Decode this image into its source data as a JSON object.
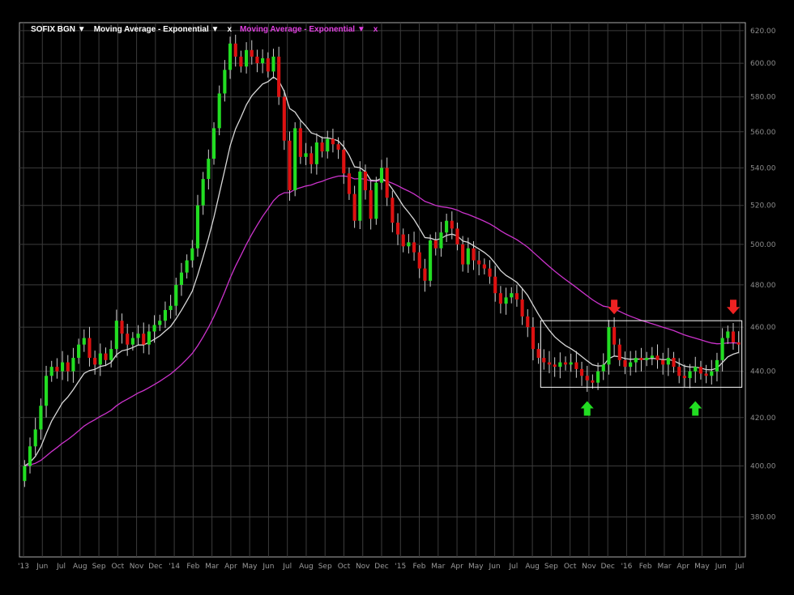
{
  "legend": {
    "symbol": "SOFIX BGN ▼",
    "ma1_label": "Moving Average - Exponential ▼",
    "ma1_close": "x",
    "ma2_label": "Moving Average - Exponential ▼",
    "ma2_close": "x"
  },
  "colors": {
    "background": "#000000",
    "grid": "#3c3c3c",
    "up": "#22dd22",
    "down": "#dd1111",
    "ma_fast": "#d8d8d8",
    "ma_slow": "#cc33cc",
    "box": "#ffffff",
    "arrow_up": "#22dd22",
    "arrow_down": "#ee2222"
  },
  "chart_data": {
    "type": "candlestick",
    "title": "",
    "xlabel": "",
    "ylabel": "",
    "ylim": [
      365,
      625
    ],
    "y_scale": "log",
    "y_ticks": [
      380,
      400,
      420,
      440,
      460,
      480,
      500,
      520,
      540,
      560,
      580,
      600,
      620
    ],
    "x_ticks": [
      "'13",
      "Jun",
      "Jul",
      "Aug",
      "Sep",
      "Oct",
      "Nov",
      "Dec",
      "'14",
      "Feb",
      "Mar",
      "Apr",
      "May",
      "Jun",
      "Jul",
      "Aug",
      "Sep",
      "Oct",
      "Nov",
      "Dec",
      "'15",
      "Feb",
      "Mar",
      "Apr",
      "May",
      "Jun",
      "Jul",
      "Aug",
      "Sep",
      "Oct",
      "Nov",
      "Dec",
      "'16",
      "Feb",
      "Mar",
      "Apr",
      "May",
      "Jun",
      "Jul"
    ],
    "close": [
      400,
      408,
      415,
      425,
      438,
      442,
      440,
      444,
      440,
      446,
      452,
      455,
      446,
      443,
      448,
      445,
      450,
      463,
      457,
      452,
      455,
      457,
      452,
      458,
      461,
      463,
      468,
      470,
      480,
      486,
      492,
      498,
      520,
      534,
      545,
      562,
      582,
      596,
      612,
      604,
      598,
      608,
      604,
      600,
      603,
      595,
      604,
      580,
      555,
      528,
      562,
      546,
      548,
      542,
      554,
      549,
      556,
      553,
      550,
      537,
      526,
      512,
      538,
      528,
      513,
      532,
      540,
      524,
      511,
      505,
      499,
      501,
      496,
      488,
      482,
      502,
      498,
      506,
      512,
      508,
      500,
      490,
      498,
      492,
      490,
      488,
      484,
      476,
      471,
      474,
      476,
      473,
      465,
      460,
      450,
      446,
      444,
      443,
      442,
      444,
      443,
      444,
      441,
      438,
      436,
      435,
      440,
      443,
      460,
      452,
      445,
      442,
      444,
      446,
      445,
      446,
      447,
      445,
      443,
      446,
      442,
      438,
      437,
      440,
      442,
      439,
      438,
      440,
      445,
      455,
      458,
      453,
      452
    ],
    "grid": true,
    "annotations": [
      "box around 2016 consolidation range",
      "up arrows at lows",
      "down arrows at highs"
    ]
  }
}
